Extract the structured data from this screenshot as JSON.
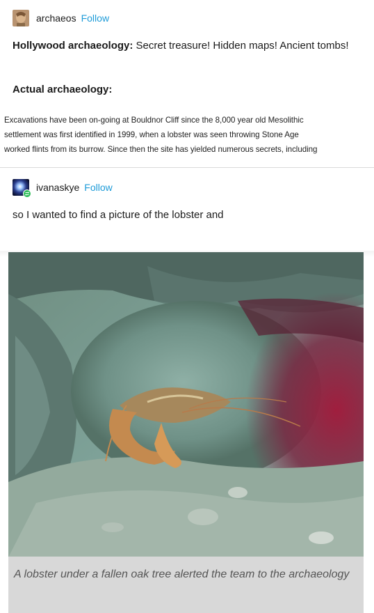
{
  "post1": {
    "username": "archaeos",
    "follow_label": "Follow",
    "hollywood_label": "Hollywood archaeology:",
    "hollywood_text": " Secret treasure! Hidden maps! Ancient tombs!",
    "actual_label": "Actual archaeology:",
    "quote_lines": [
      "Excavations have been on-going at Bouldnor Cliff since the 8,000 year old Mesolithic",
      "settlement was first identified in 1999, when a lobster was seen throwing Stone Age",
      "worked flints from its burrow. Since then the site has yielded numerous secrets, including"
    ]
  },
  "post2": {
    "username": "ivanaskye",
    "follow_label": "Follow",
    "text": "so I wanted to find a picture of the lobster and"
  },
  "image": {
    "icon": "lobster-photo",
    "caption": "A lobster under a fallen oak tree alerted the team to the archaeology"
  },
  "colors": {
    "follow": "#1d9bd8",
    "badge": "#2ebd59",
    "caption_bg": "#d8d8d8"
  }
}
